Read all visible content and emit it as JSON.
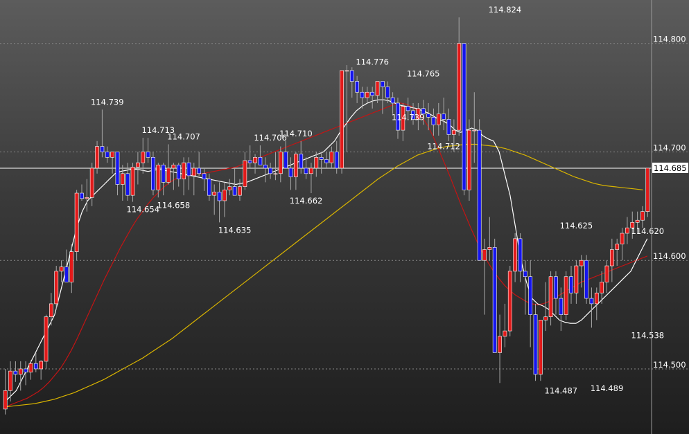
{
  "chart_data": {
    "type": "candlestick",
    "ylim": [
      114.44,
      114.84
    ],
    "grid": true,
    "y_ticks": [
      "114.800",
      "114.700",
      "114.600",
      "114.500"
    ],
    "current_price": "114.685",
    "colors": {
      "up": "#e31a1a",
      "down": "#1515ee",
      "wick": "#aaaaaa",
      "grid": "#888888",
      "price_line": "#ffffff",
      "ma_short": "#ffffff",
      "ma_mid": "#c41414",
      "ma_long": "#d9b400"
    },
    "annotations": [
      {
        "text": "114.824",
        "price": 114.824,
        "bar": 98,
        "pos": "above"
      },
      {
        "text": "114.776",
        "price": 114.776,
        "bar": 72,
        "pos": "above"
      },
      {
        "text": "114.765",
        "price": 114.765,
        "bar": 82,
        "pos": "above"
      },
      {
        "text": "114.739",
        "price": 114.739,
        "bar": 20,
        "pos": "above"
      },
      {
        "text": "114.713",
        "price": 114.713,
        "bar": 30,
        "pos": "above"
      },
      {
        "text": "114.707",
        "price": 114.707,
        "bar": 35,
        "pos": "above"
      },
      {
        "text": "114.706",
        "price": 114.706,
        "bar": 52,
        "pos": "above"
      },
      {
        "text": "114.710",
        "price": 114.71,
        "bar": 57,
        "pos": "above"
      },
      {
        "text": "114.739",
        "price": 114.739,
        "bar": 79,
        "pos": "below"
      },
      {
        "text": "114.712",
        "price": 114.712,
        "bar": 86,
        "pos": "below"
      },
      {
        "text": "114.654",
        "price": 114.654,
        "bar": 27,
        "pos": "below"
      },
      {
        "text": "114.658",
        "price": 114.658,
        "bar": 33,
        "pos": "below"
      },
      {
        "text": "114.662",
        "price": 114.662,
        "bar": 59,
        "pos": "below"
      },
      {
        "text": "114.635",
        "price": 114.635,
        "bar": 45,
        "pos": "below"
      },
      {
        "text": "114.625",
        "price": 114.625,
        "bar": 112,
        "pos": "above"
      },
      {
        "text": "114.620",
        "price": 114.62,
        "bar": 128,
        "pos": "above"
      },
      {
        "text": "114.538",
        "price": 114.538,
        "bar": 128,
        "pos": "below"
      },
      {
        "text": "114.487",
        "price": 114.487,
        "bar": 109,
        "pos": "below"
      },
      {
        "text": "114.489",
        "price": 114.489,
        "bar": 118,
        "pos": "below"
      }
    ],
    "ohlc": [
      [
        114.463,
        114.5,
        114.458,
        114.48
      ],
      [
        114.48,
        114.507,
        114.47,
        114.498
      ],
      [
        114.498,
        114.507,
        114.488,
        114.495
      ],
      [
        114.495,
        114.507,
        114.48,
        114.5
      ],
      [
        114.5,
        114.507,
        114.485,
        114.497
      ],
      [
        114.497,
        114.508,
        114.49,
        114.505
      ],
      [
        114.505,
        114.515,
        114.497,
        114.5
      ],
      [
        114.5,
        114.508,
        114.49,
        114.507
      ],
      [
        114.507,
        114.55,
        114.5,
        114.548
      ],
      [
        114.548,
        114.57,
        114.54,
        114.56
      ],
      [
        114.56,
        114.595,
        114.555,
        114.59
      ],
      [
        114.59,
        114.6,
        114.58,
        114.594
      ],
      [
        114.594,
        114.61,
        114.585,
        114.58
      ],
      [
        114.58,
        114.615,
        114.57,
        114.608
      ],
      [
        114.608,
        114.665,
        114.6,
        114.662
      ],
      [
        114.662,
        114.67,
        114.655,
        114.657
      ],
      [
        114.657,
        114.675,
        114.645,
        114.658
      ],
      [
        114.658,
        114.69,
        114.65,
        114.685
      ],
      [
        114.685,
        114.71,
        114.68,
        114.705
      ],
      [
        114.705,
        114.739,
        114.695,
        114.7
      ],
      [
        114.7,
        114.705,
        114.69,
        114.695
      ],
      [
        114.695,
        114.7,
        114.68,
        114.7
      ],
      [
        114.7,
        114.7,
        114.66,
        114.67
      ],
      [
        114.67,
        114.688,
        114.655,
        114.68
      ],
      [
        114.68,
        114.69,
        114.655,
        114.66
      ],
      [
        114.66,
        114.69,
        114.654,
        114.686
      ],
      [
        114.686,
        114.7,
        114.67,
        114.69
      ],
      [
        114.69,
        114.713,
        114.68,
        114.7
      ],
      [
        114.7,
        114.713,
        114.69,
        114.695
      ],
      [
        114.695,
        114.7,
        114.66,
        114.665
      ],
      [
        114.665,
        114.69,
        114.658,
        114.688
      ],
      [
        114.688,
        114.69,
        114.66,
        114.672
      ],
      [
        114.672,
        114.707,
        114.67,
        114.685
      ],
      [
        114.685,
        114.69,
        114.665,
        114.688
      ],
      [
        114.688,
        114.69,
        114.668,
        114.675
      ],
      [
        114.675,
        114.695,
        114.66,
        114.69
      ],
      [
        114.69,
        114.695,
        114.665,
        114.678
      ],
      [
        114.678,
        114.69,
        114.66,
        114.685
      ],
      [
        114.685,
        114.7,
        114.678,
        114.68
      ],
      [
        114.68,
        114.685,
        114.664,
        114.675
      ],
      [
        114.675,
        114.68,
        114.655,
        114.66
      ],
      [
        114.66,
        114.67,
        114.642,
        114.663
      ],
      [
        114.663,
        114.672,
        114.635,
        114.655
      ],
      [
        114.655,
        114.672,
        114.64,
        114.665
      ],
      [
        114.665,
        114.675,
        114.66,
        114.668
      ],
      [
        114.668,
        114.685,
        114.662,
        114.66
      ],
      [
        114.66,
        114.675,
        114.655,
        114.668
      ],
      [
        114.668,
        114.7,
        114.665,
        114.692
      ],
      [
        114.692,
        114.706,
        114.685,
        114.69
      ],
      [
        114.69,
        114.698,
        114.68,
        114.695
      ],
      [
        114.695,
        114.706,
        114.688,
        114.688
      ],
      [
        114.688,
        114.695,
        114.672,
        114.685
      ],
      [
        114.685,
        114.69,
        114.675,
        114.68
      ],
      [
        114.68,
        114.7,
        114.674,
        114.68
      ],
      [
        114.68,
        114.705,
        114.672,
        114.7
      ],
      [
        114.7,
        114.71,
        114.69,
        114.685
      ],
      [
        114.685,
        114.695,
        114.665,
        114.677
      ],
      [
        114.677,
        114.7,
        114.665,
        114.698
      ],
      [
        114.698,
        114.71,
        114.68,
        114.685
      ],
      [
        114.685,
        114.695,
        114.675,
        114.68
      ],
      [
        114.68,
        114.69,
        114.662,
        114.685
      ],
      [
        114.685,
        114.7,
        114.677,
        114.695
      ],
      [
        114.695,
        114.7,
        114.68,
        114.693
      ],
      [
        114.693,
        114.7,
        114.685,
        114.69
      ],
      [
        114.69,
        114.705,
        114.685,
        114.7
      ],
      [
        114.7,
        114.71,
        114.68,
        114.685
      ],
      [
        114.685,
        114.71,
        114.68,
        114.775
      ],
      [
        114.775,
        114.78,
        114.7,
        114.775
      ],
      [
        114.775,
        114.778,
        114.75,
        114.765
      ],
      [
        114.765,
        114.77,
        114.745,
        114.755
      ],
      [
        114.755,
        114.76,
        114.74,
        114.75
      ],
      [
        114.75,
        114.76,
        114.745,
        114.755
      ],
      [
        114.755,
        114.76,
        114.74,
        114.752
      ],
      [
        114.752,
        114.765,
        114.745,
        114.765
      ],
      [
        114.765,
        114.765,
        114.735,
        114.76
      ],
      [
        114.76,
        114.765,
        114.745,
        114.75
      ],
      [
        114.75,
        114.755,
        114.735,
        114.745
      ],
      [
        114.745,
        114.75,
        114.712,
        114.72
      ],
      [
        114.72,
        114.745,
        114.71,
        114.742
      ],
      [
        114.742,
        114.75,
        114.73,
        114.738
      ],
      [
        114.738,
        114.745,
        114.725,
        114.73
      ],
      [
        114.73,
        114.745,
        114.72,
        114.74
      ],
      [
        114.74,
        114.748,
        114.725,
        114.735
      ],
      [
        114.735,
        114.745,
        114.72,
        114.732
      ],
      [
        114.732,
        114.74,
        114.715,
        114.725
      ],
      [
        114.725,
        114.745,
        114.715,
        114.735
      ],
      [
        114.735,
        114.75,
        114.72,
        114.73
      ],
      [
        114.73,
        114.74,
        114.71,
        114.716
      ],
      [
        114.716,
        114.73,
        114.7,
        114.72
      ],
      [
        114.72,
        114.824,
        114.715,
        114.8
      ],
      [
        114.8,
        114.8,
        114.66,
        114.665
      ],
      [
        114.665,
        114.73,
        114.655,
        114.72
      ],
      [
        114.72,
        114.755,
        114.69,
        114.72
      ],
      [
        114.72,
        114.73,
        114.64,
        114.6
      ],
      [
        114.6,
        114.62,
        114.55,
        114.61
      ],
      [
        114.61,
        114.64,
        114.6,
        114.612
      ],
      [
        114.612,
        114.62,
        114.52,
        114.515
      ],
      [
        114.515,
        114.55,
        114.487,
        114.53
      ],
      [
        114.53,
        114.56,
        114.52,
        114.535
      ],
      [
        114.535,
        114.595,
        114.53,
        114.59
      ],
      [
        114.59,
        114.625,
        114.58,
        114.62
      ],
      [
        114.62,
        114.625,
        114.58,
        114.59
      ],
      [
        114.59,
        114.6,
        114.55,
        114.585
      ],
      [
        114.585,
        114.6,
        114.52,
        114.55
      ],
      [
        114.55,
        114.56,
        114.489,
        114.495
      ],
      [
        114.495,
        114.545,
        114.489,
        114.545
      ],
      [
        114.545,
        114.58,
        114.535,
        114.548
      ],
      [
        114.548,
        114.59,
        114.54,
        114.585
      ],
      [
        114.585,
        114.59,
        114.55,
        114.565
      ],
      [
        114.565,
        114.575,
        114.535,
        114.55
      ],
      [
        114.55,
        114.59,
        114.545,
        114.585
      ],
      [
        114.585,
        114.595,
        114.56,
        114.57
      ],
      [
        114.57,
        114.6,
        114.56,
        114.595
      ],
      [
        114.595,
        114.605,
        114.575,
        114.6
      ],
      [
        114.6,
        114.605,
        114.56,
        114.565
      ],
      [
        114.565,
        114.575,
        114.538,
        114.56
      ],
      [
        114.56,
        114.575,
        114.545,
        114.57
      ],
      [
        114.57,
        114.59,
        114.56,
        114.58
      ],
      [
        114.58,
        114.6,
        114.57,
        114.595
      ],
      [
        114.595,
        114.62,
        114.58,
        114.61
      ],
      [
        114.61,
        114.62,
        114.595,
        114.615
      ],
      [
        114.615,
        114.63,
        114.6,
        114.625
      ],
      [
        114.625,
        114.64,
        114.615,
        114.63
      ],
      [
        114.63,
        114.645,
        114.62,
        114.635
      ],
      [
        114.635,
        114.645,
        114.625,
        114.637
      ],
      [
        114.637,
        114.65,
        114.63,
        114.645
      ],
      [
        114.645,
        114.685,
        114.64,
        114.685
      ]
    ],
    "ma_short": [
      114.47,
      114.475,
      114.48,
      114.49,
      114.5,
      114.51,
      114.52,
      114.53,
      114.54,
      114.55,
      114.57,
      114.59,
      114.61,
      114.63,
      114.645,
      114.655,
      114.66,
      114.665,
      114.67,
      114.675,
      114.68,
      114.682,
      114.683,
      114.684,
      114.684,
      114.683,
      114.682,
      114.683,
      114.684,
      114.683,
      114.682,
      114.681,
      114.68,
      114.679,
      114.678,
      114.677,
      114.676,
      114.675,
      114.674,
      114.673,
      114.672,
      114.671,
      114.67,
      114.671,
      114.672,
      114.674,
      114.676,
      114.678,
      114.68,
      114.682,
      114.684,
      114.686,
      114.688,
      114.69,
      114.692,
      114.694,
      114.696,
      114.698,
      114.7,
      114.705,
      114.71,
      114.718,
      114.725,
      114.732,
      114.738,
      114.742,
      114.745,
      114.747,
      114.748,
      114.748,
      114.747,
      114.745,
      114.743,
      114.742,
      114.741,
      114.74,
      114.738,
      114.736,
      114.733,
      114.73,
      114.728,
      114.725,
      114.72,
      114.718,
      114.72,
      114.722,
      114.72,
      114.715,
      114.712,
      114.71,
      114.7,
      114.68,
      114.66,
      114.63,
      114.6,
      114.58,
      114.565,
      114.56,
      114.558,
      114.555,
      114.55,
      114.545,
      114.543,
      114.542,
      114.542,
      114.545,
      114.55,
      114.555,
      114.56,
      114.565,
      114.57,
      114.575,
      114.58,
      114.585,
      114.59,
      114.6,
      114.61,
      114.62
    ],
    "ma_mid": [
      114.465,
      114.467,
      114.469,
      114.471,
      114.473,
      114.476,
      114.479,
      114.483,
      114.488,
      114.494,
      114.5,
      114.508,
      114.517,
      114.527,
      114.538,
      114.549,
      114.56,
      114.571,
      114.582,
      114.592,
      114.602,
      114.612,
      114.621,
      114.63,
      114.638,
      114.645,
      114.652,
      114.658,
      114.663,
      114.668,
      114.672,
      114.675,
      114.677,
      114.678,
      114.679,
      114.68,
      114.68,
      114.681,
      114.682,
      114.683,
      114.684,
      114.685,
      114.686,
      114.688,
      114.69,
      114.692,
      114.694,
      114.696,
      114.698,
      114.7,
      114.702,
      114.704,
      114.706,
      114.708,
      114.71,
      114.712,
      114.714,
      114.716,
      114.718,
      114.72,
      114.722,
      114.724,
      114.726,
      114.728,
      114.73,
      114.732,
      114.734,
      114.736,
      114.738,
      114.74,
      114.742,
      114.744,
      114.745,
      114.744,
      114.742,
      114.738,
      114.732,
      114.724,
      114.714,
      114.702,
      114.69,
      114.678,
      114.665,
      114.652,
      114.64,
      114.628,
      114.617,
      114.607,
      114.598,
      114.59,
      114.583,
      114.577,
      114.572,
      114.568,
      114.565,
      114.562,
      114.56,
      114.559,
      114.56,
      114.562,
      114.565,
      114.568,
      114.571,
      114.574,
      114.577,
      114.58,
      114.582,
      114.584,
      114.586,
      114.588,
      114.59,
      114.592,
      114.594,
      114.596,
      114.598,
      114.6,
      114.602,
      114.604
    ],
    "ma_long": [
      114.465,
      114.466,
      114.467,
      114.468,
      114.47,
      114.472,
      114.475,
      114.478,
      114.482,
      114.486,
      114.49,
      114.495,
      114.5,
      114.505,
      114.51,
      114.516,
      114.522,
      114.528,
      114.535,
      114.542,
      114.549,
      114.556,
      114.563,
      114.57,
      114.577,
      114.584,
      114.591,
      114.598,
      114.605,
      114.612,
      114.619,
      114.626,
      114.633,
      114.64,
      114.647,
      114.654,
      114.661,
      114.668,
      114.675,
      114.681,
      114.687,
      114.692,
      114.697,
      114.7,
      114.703,
      114.705,
      114.706,
      114.707,
      114.707,
      114.706,
      114.705,
      114.703,
      114.7,
      114.697,
      114.693,
      114.689,
      114.685,
      114.681,
      114.677,
      114.674,
      114.671,
      114.669,
      114.668,
      114.667,
      114.666,
      114.665
    ],
    "ma_long_start_bar": 64
  }
}
